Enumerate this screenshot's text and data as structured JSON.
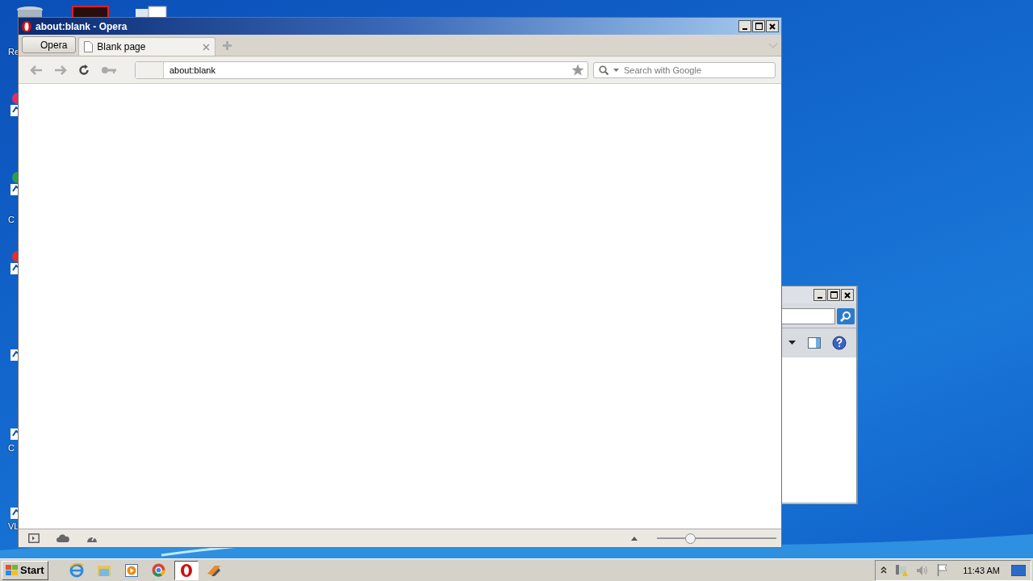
{
  "desktop": {
    "labels": [
      "Re",
      "C",
      "C",
      "VL"
    ]
  },
  "browser": {
    "title": "about:blank - Opera",
    "menu_button": "Opera",
    "tabs": [
      {
        "label": "Blank page",
        "selected": true
      }
    ],
    "address": "about:blank",
    "search": {
      "placeholder": "Search with Google"
    },
    "zoom": {
      "level": 0.28
    }
  },
  "taskbar": {
    "start": "Start",
    "apps": [
      {
        "kind": "ie",
        "selected": false
      },
      {
        "kind": "folder",
        "selected": false
      },
      {
        "kind": "media",
        "selected": false
      },
      {
        "kind": "chrome",
        "selected": false
      },
      {
        "kind": "opera",
        "selected": true
      },
      {
        "kind": "tool",
        "selected": false
      }
    ],
    "clock": "11:43 AM"
  }
}
